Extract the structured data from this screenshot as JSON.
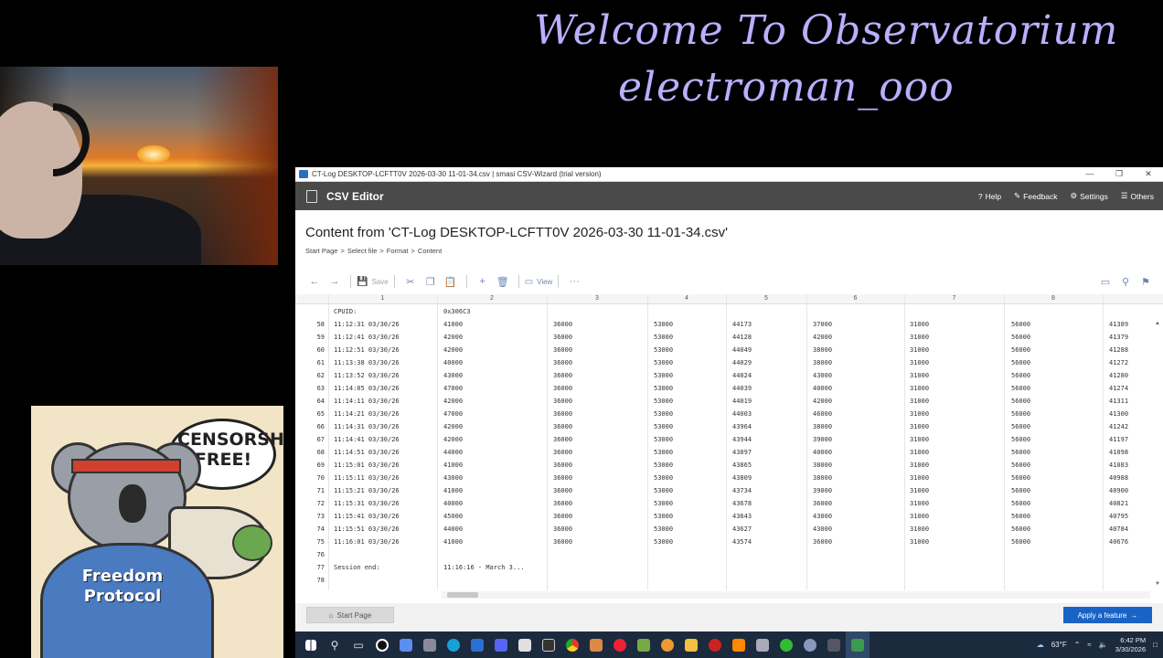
{
  "overlay": {
    "title_line1": "Welcome To Observatorium",
    "title_line2": "electroman_ooo",
    "koala_bubble": "CENSORSHIP FREE!",
    "koala_hoodie": "Freedom Protocol"
  },
  "window": {
    "title": "CT-Log DESKTOP-LCFTT0V 2026-03-30 11-01-34.csv | smasi CSV-Wizard (trial version)",
    "app_name": "CSV Editor",
    "menu": {
      "help": "Help",
      "feedback": "Feedback",
      "settings": "Settings",
      "others": "Others"
    },
    "heading": "Content from 'CT-Log DESKTOP-LCFTT0V 2026-03-30 11-01-34.csv'",
    "breadcrumb": [
      "Start Page",
      "Select file",
      "Format",
      "Content"
    ],
    "toolbar": {
      "save": "Save",
      "view": "View",
      "more": "···"
    },
    "footer": {
      "start_page": "Start Page",
      "apply_feature": "Apply a feature"
    }
  },
  "table": {
    "column_headers": [
      "1",
      "2",
      "3",
      "4",
      "5",
      "6",
      "7",
      "8"
    ],
    "header_row": {
      "c1": "CPUID:",
      "c2": "0x306C3"
    },
    "rows": [
      {
        "n": "58",
        "c": [
          "11:12:31 03/30/26",
          "41000",
          "36000",
          "53000",
          "44173",
          "37000",
          "31000",
          "56000",
          "41389"
        ]
      },
      {
        "n": "59",
        "c": [
          "11:12:41 03/30/26",
          "42000",
          "36000",
          "53000",
          "44128",
          "42000",
          "31000",
          "56000",
          "41379"
        ]
      },
      {
        "n": "60",
        "c": [
          "11:12:51 03/30/26",
          "42000",
          "36000",
          "53000",
          "44049",
          "38000",
          "31000",
          "56000",
          "41288"
        ]
      },
      {
        "n": "61",
        "c": [
          "11:13:38 03/30/26",
          "40000",
          "36000",
          "53000",
          "44029",
          "38000",
          "31000",
          "56000",
          "41272"
        ]
      },
      {
        "n": "62",
        "c": [
          "11:13:52 03/30/26",
          "43000",
          "36000",
          "53000",
          "44024",
          "43000",
          "31000",
          "56000",
          "41280"
        ]
      },
      {
        "n": "63",
        "c": [
          "11:14:05 03/30/26",
          "47000",
          "36000",
          "53000",
          "44039",
          "40000",
          "31000",
          "56000",
          "41274"
        ]
      },
      {
        "n": "64",
        "c": [
          "11:14:11 03/30/26",
          "42000",
          "36000",
          "53000",
          "44019",
          "42000",
          "31000",
          "56000",
          "41311"
        ]
      },
      {
        "n": "65",
        "c": [
          "11:14:21 03/30/26",
          "47000",
          "36000",
          "53000",
          "44003",
          "46000",
          "31000",
          "56000",
          "41300"
        ]
      },
      {
        "n": "66",
        "c": [
          "11:14:31 03/30/26",
          "42000",
          "36000",
          "53000",
          "43964",
          "38000",
          "31000",
          "56000",
          "41242"
        ]
      },
      {
        "n": "67",
        "c": [
          "11:14:41 03/30/26",
          "42000",
          "36000",
          "53000",
          "43944",
          "39000",
          "31000",
          "56000",
          "41197"
        ]
      },
      {
        "n": "68",
        "c": [
          "11:14:51 03/30/26",
          "44000",
          "36000",
          "53000",
          "43897",
          "40000",
          "31000",
          "56000",
          "41098"
        ]
      },
      {
        "n": "69",
        "c": [
          "11:15:01 03/30/26",
          "41000",
          "36000",
          "53000",
          "43865",
          "38000",
          "31000",
          "56000",
          "41083"
        ]
      },
      {
        "n": "70",
        "c": [
          "11:15:11 03/30/26",
          "43000",
          "36000",
          "53000",
          "43809",
          "38000",
          "31000",
          "56000",
          "40988"
        ]
      },
      {
        "n": "71",
        "c": [
          "11:15:21 03/30/26",
          "41000",
          "36000",
          "53000",
          "43734",
          "39000",
          "31000",
          "56000",
          "40900"
        ]
      },
      {
        "n": "72",
        "c": [
          "11:15:31 03/30/26",
          "40000",
          "36000",
          "53000",
          "43678",
          "36000",
          "31000",
          "56000",
          "40821"
        ]
      },
      {
        "n": "73",
        "c": [
          "11:15:41 03/30/26",
          "45000",
          "36000",
          "53000",
          "43643",
          "43000",
          "31000",
          "56000",
          "40795"
        ]
      },
      {
        "n": "74",
        "c": [
          "11:15:51 03/30/26",
          "44000",
          "36000",
          "53000",
          "43627",
          "43000",
          "31000",
          "56000",
          "40784"
        ]
      },
      {
        "n": "75",
        "c": [
          "11:16:01 03/30/26",
          "41000",
          "36000",
          "53000",
          "43574",
          "36000",
          "31000",
          "56000",
          "40676"
        ]
      },
      {
        "n": "76",
        "c": [
          "",
          "",
          "",
          "",
          "",
          "",
          "",
          "",
          ""
        ]
      },
      {
        "n": "77",
        "c": [
          "Session end:",
          "11:16:16 - March 3...",
          "",
          "",
          "",
          "",
          "",
          "",
          ""
        ]
      },
      {
        "n": "78",
        "c": [
          "",
          "",
          "",
          "",
          "",
          "",
          "",
          "",
          ""
        ]
      }
    ]
  },
  "taskbar": {
    "weather": "63°F",
    "time": "6:42 PM",
    "date": "3/30/2026"
  }
}
